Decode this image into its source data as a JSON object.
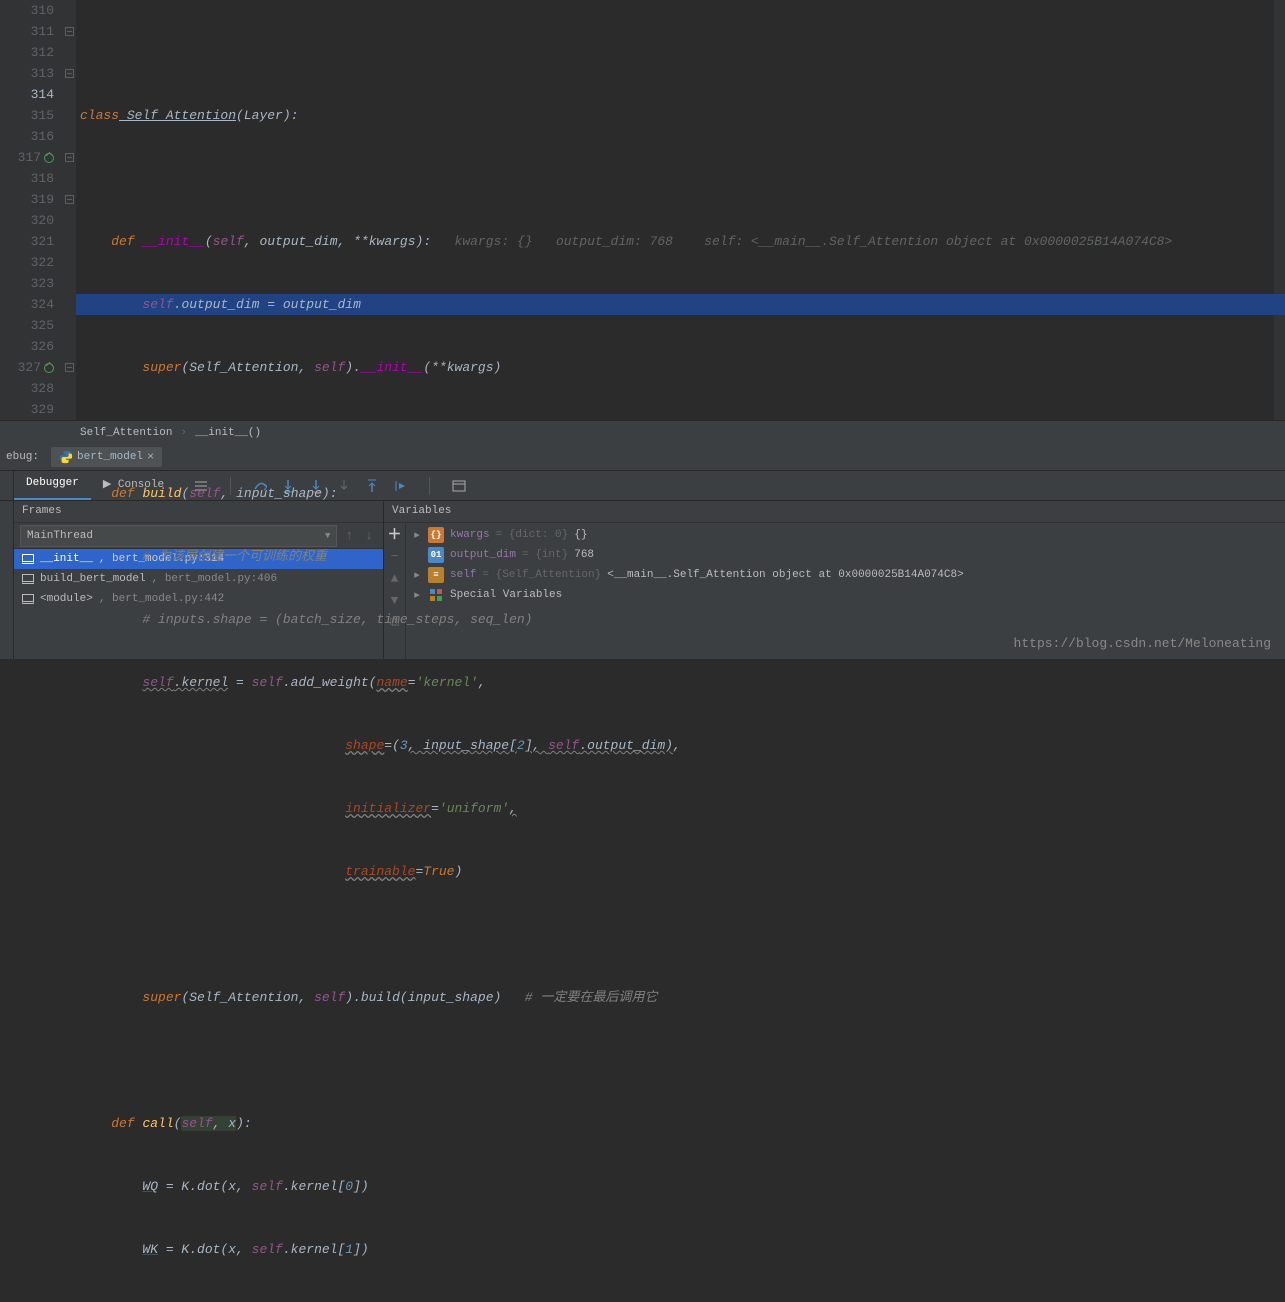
{
  "gutter_lines": [
    "310",
    "311",
    "312",
    "313",
    "314",
    "315",
    "316",
    "317",
    "318",
    "319",
    "320",
    "321",
    "322",
    "323",
    "324",
    "325",
    "326",
    "327",
    "328",
    "329"
  ],
  "current_line": "314",
  "code": {
    "l310": "",
    "l311": {
      "kw1": "class",
      "name": " Self_Attention",
      "paren": "(Layer):"
    },
    "l313": {
      "kw": "def ",
      "name": "__init__",
      "sig": "(",
      "self": "self",
      "sig2": ", output_dim, **kwargs):",
      "inlay": "   kwargs: {}   output_dim: 768    self: <__main__.Self_Attention object at 0x0000025B14A074C8>"
    },
    "l314": {
      "self": "self",
      "rest": ".output_dim = output_dim"
    },
    "l315": {
      "pre": "super(Self_Attention, ",
      "self": "self",
      ")": ").",
      "magic": "__init__",
      "post": "(**kwargs)"
    },
    "l317": {
      "kw": "def ",
      "name": "build",
      "sig": "(",
      "self": "self",
      "sig2": ", input_shape):"
    },
    "l318": "# 为该层创建一个可训练的权重",
    "l319": "# inputs.shape = (batch_size, time_steps, seq_len)",
    "l320": {
      "self": "self",
      "dot": ".kernel = ",
      "self2": "self",
      "rest": ".add_weight(",
      "kw": "name",
      "eq": "=",
      "str": "'kernel'",
      "comma": ","
    },
    "l321": {
      "kw": "shape",
      "eq": "=(",
      "num": "3",
      "mid": ", input_shape[",
      "num2": "2",
      "mid2": "], ",
      "self": "self",
      "rest": ".output_dim),"
    },
    "l322": {
      "kw": "initializer",
      "eq": "=",
      "str": "'uniform'",
      "comma": ","
    },
    "l323": {
      "kw": "trainable",
      "eq": "=",
      "val": "True",
      ")": ")"
    },
    "l325": {
      "pre": "super(Self_Attention, ",
      "self": "self",
      ")": ").build(input_shape)",
      "com": "   # 一定要在最后调用它"
    },
    "l327": {
      "kw": "def ",
      "name": "call",
      "sig": "(",
      "self": "self",
      "sig2": ", x):"
    },
    "l328": {
      "var": "WQ",
      " = K.dot(x, ": " = K.dot(x, ",
      "self": "self",
      ".kernel[": ".kernel[",
      "num": "0",
      "])": "])"
    },
    "l329": {
      "var": "WK",
      " = K.dot(x, ": " = K.dot(x, ",
      "self": "self",
      ".kernel[": ".kernel[",
      "num": "1",
      "])": "])"
    }
  },
  "breadcrumb": {
    "a": "Self_Attention",
    "b": "__init__()"
  },
  "debug": {
    "label": "ebug:",
    "tab": "bert_model"
  },
  "toolbar_tabs": {
    "debugger": "Debugger",
    "console": "Console"
  },
  "frames": {
    "header": "Frames",
    "thread": "MainThread",
    "items": [
      {
        "name": "__init__",
        "loc": ", bert_model.py:314"
      },
      {
        "name": "build_bert_model",
        "loc": ", bert_model.py:406"
      },
      {
        "name": "<module>",
        "loc": ", bert_model.py:442"
      }
    ]
  },
  "variables": {
    "header": "Variables",
    "items": [
      {
        "arrow": "▸",
        "icon": "brace",
        "name": "kwargs",
        "type": " = {dict: 0}",
        "val": " {}"
      },
      {
        "arrow": "",
        "icon": "01",
        "name": "output_dim",
        "type": " = {int}",
        "val": " 768"
      },
      {
        "arrow": "▸",
        "icon": "obj",
        "name": "self",
        "type": " = {Self_Attention}",
        "val": " <__main__.Self_Attention object at 0x0000025B14A074C8>"
      },
      {
        "arrow": "▸",
        "icon": "grid",
        "name": "Special Variables",
        "type": "",
        "val": ""
      }
    ]
  },
  "watermark": "https://blog.csdn.net/Meloneating"
}
